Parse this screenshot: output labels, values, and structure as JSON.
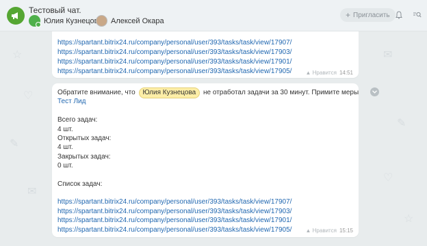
{
  "header": {
    "title": "Тестовый чат.",
    "members": [
      {
        "name": "Юлия Кузнецова"
      },
      {
        "name": "Алексей Окара"
      }
    ],
    "invite_label": "Пригласить",
    "icons": [
      "megaphone-icon",
      "bell-icon",
      "search-icon"
    ]
  },
  "messages": [
    {
      "links": [
        "https://spartant.bitrix24.ru/company/personal/user/393/tasks/task/view/17907/",
        "https://spartant.bitrix24.ru/company/personal/user/393/tasks/task/view/17903/",
        "https://spartant.bitrix24.ru/company/personal/user/393/tasks/task/view/17901/",
        "https://spartant.bitrix24.ru/company/personal/user/393/tasks/task/view/17905/"
      ],
      "like_label": "Нравится",
      "time": "14:51"
    },
    {
      "intro_before": "Обратите внимание, что",
      "mention": "Юлия Кузнецова",
      "intro_after": "не отработал задачи за 30 минут. Примите меры",
      "mention_link": "Тест Лид",
      "stats": [
        "Всего задач:",
        "4 шт.",
        "Открытых задач:",
        "4 шт.",
        "Закрытых задач:",
        "0 шт."
      ],
      "list_title": "Список задач:",
      "links": [
        "https://spartant.bitrix24.ru/company/personal/user/393/tasks/task/view/17907/",
        "https://spartant.bitrix24.ru/company/personal/user/393/tasks/task/view/17903/",
        "https://spartant.bitrix24.ru/company/personal/user/393/tasks/task/view/17901/",
        "https://spartant.bitrix24.ru/company/personal/user/393/tasks/task/view/17905/"
      ],
      "like_label": "Нравится",
      "time": "15:15"
    }
  ],
  "colors": {
    "accent_link": "#2067b0",
    "mention_bg": "#fdeea7",
    "online_green": "#4fb04b"
  }
}
